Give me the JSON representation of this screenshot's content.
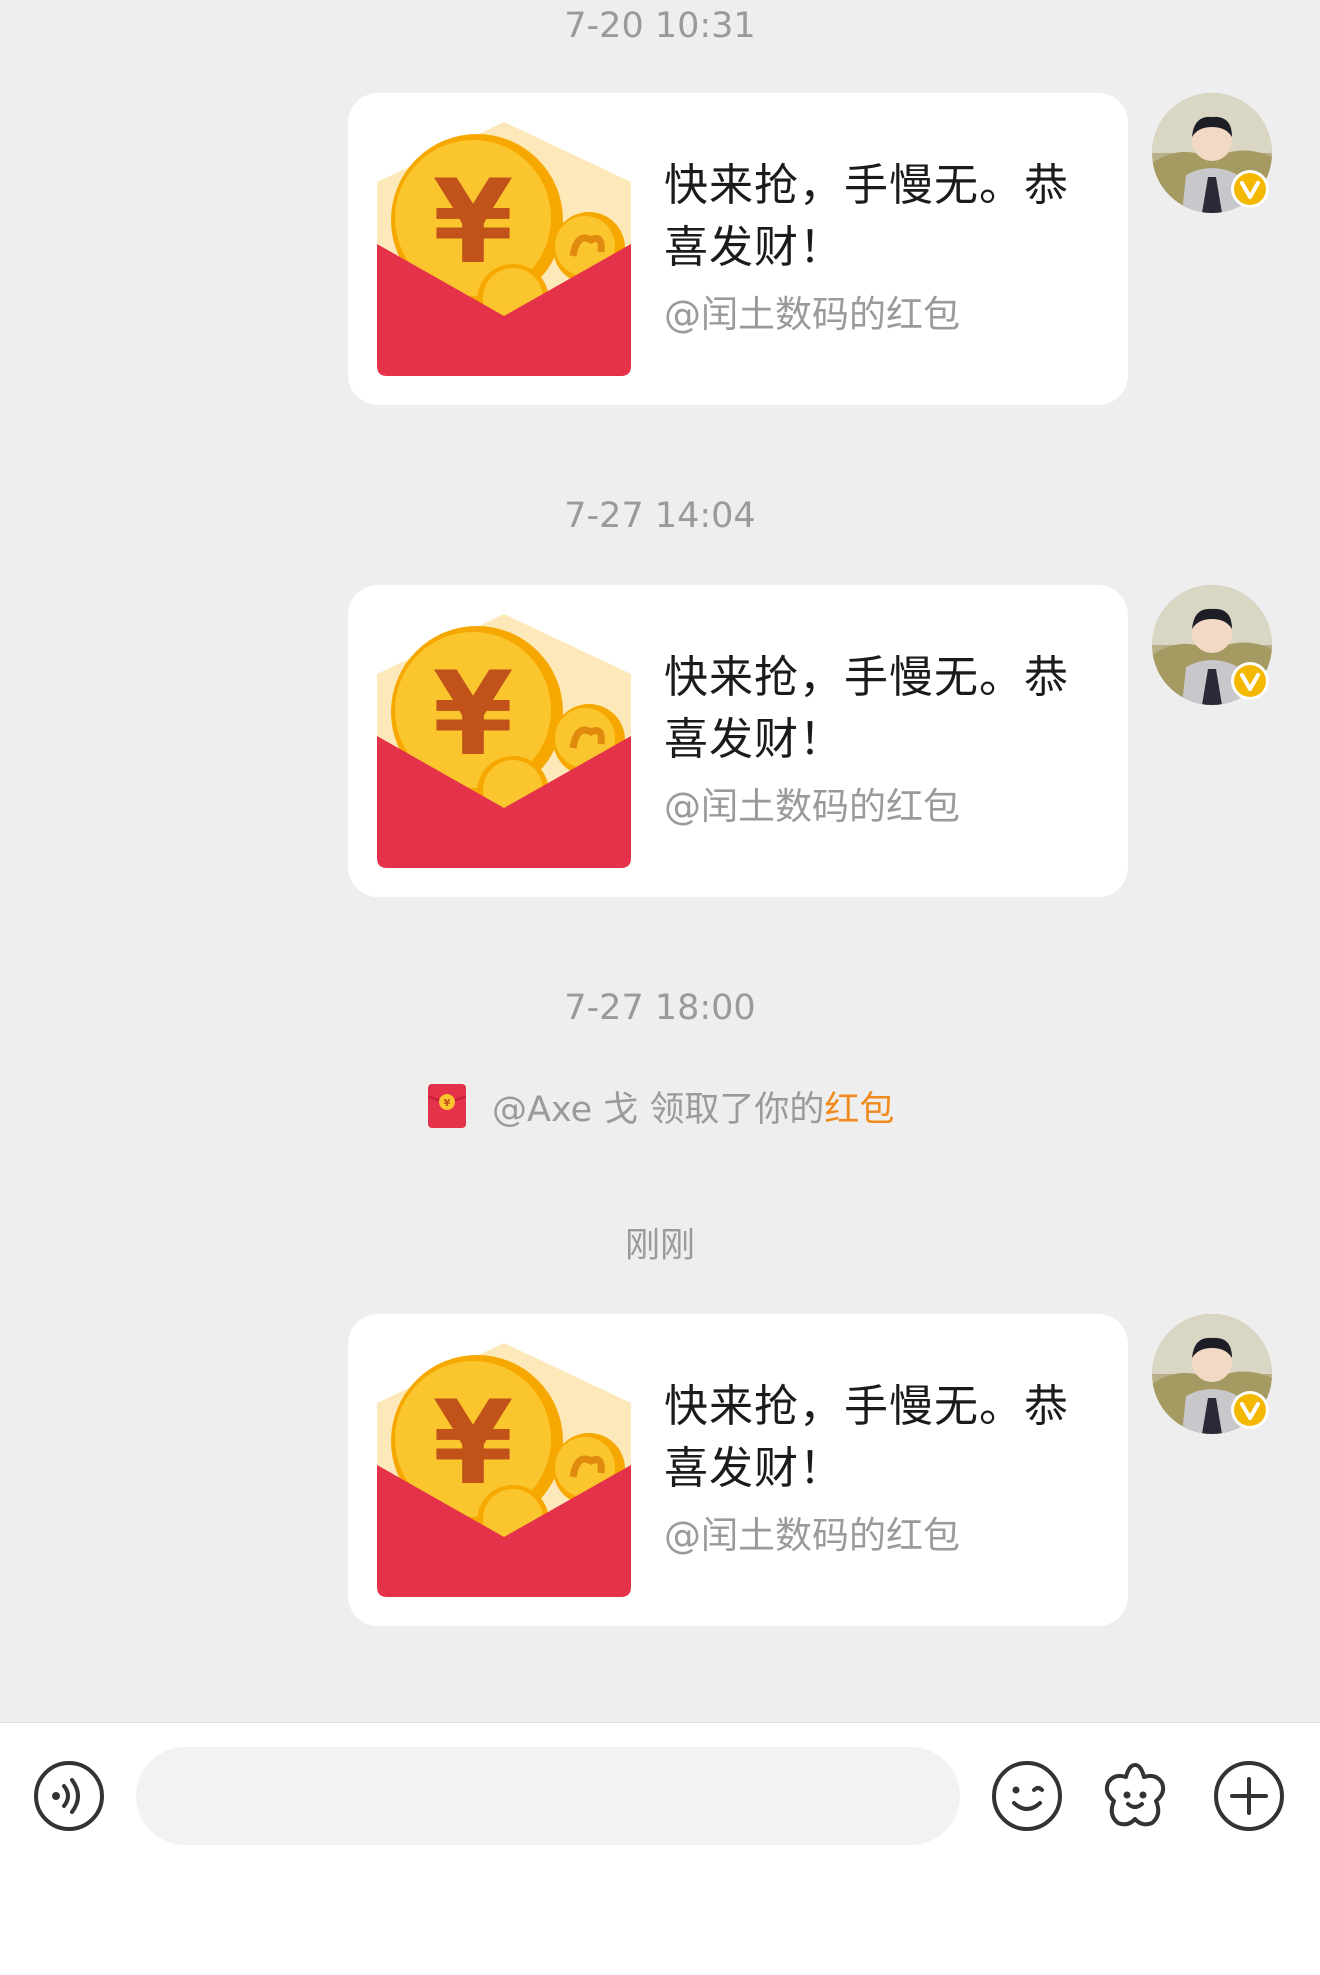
{
  "chat": {
    "timestamps": [
      "7-20 10:31",
      "7-27 14:04",
      "7-27 18:00",
      "刚刚"
    ],
    "messages": [
      {
        "text": "快来抢，手慢无。恭喜发财！",
        "sub": "@闰土数码的红包"
      },
      {
        "text": "快来抢，手慢无。恭喜发财！",
        "sub": "@闰土数码的红包"
      },
      {
        "text": "快来抢，手慢无。恭喜发财！",
        "sub": "@闰土数码的红包"
      }
    ],
    "notice": {
      "prefix": "@Axe 戈 领取了你的",
      "link": "红包"
    }
  },
  "input_bar": {
    "input_value": "",
    "icons": [
      "voice-icon",
      "emoji-icon",
      "sticker-icon",
      "plus-icon"
    ]
  },
  "colors": {
    "background": "#eeeeee",
    "bubble": "#ffffff",
    "packet_red": "#e33249",
    "coin_gold": "#fbc52d",
    "link_orange": "#f08a1c",
    "verified_badge": "#f5b800"
  }
}
